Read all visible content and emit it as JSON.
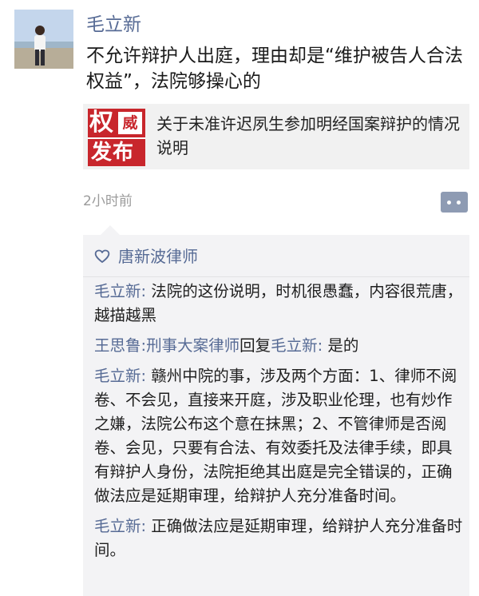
{
  "post": {
    "author": "毛立新",
    "text": "不允许辩护人出庭，理由却是“维护被告人合法权益”，法院够操心的",
    "time": "2小时前"
  },
  "shared": {
    "thumb_char_1": "权",
    "thumb_char_2": "威",
    "thumb_bottom": "发布",
    "title": "关于未准许迟夙生参加明经国案辩护的情况说明"
  },
  "likes": {
    "names": "唐新波律师"
  },
  "comments": [
    {
      "author": "毛立新",
      "sep": ": ",
      "text": "法院的这份说明，时机很愚蠢，内容很荒唐，越描越黑"
    },
    {
      "author": "王思鲁:刑事大案律师",
      "reply_word": "回复",
      "reply_to": "毛立新",
      "sep": ": ",
      "text": "是的"
    },
    {
      "author": "毛立新",
      "sep": ": ",
      "text": "赣州中院的事，涉及两个方面：1、律师不阅卷、不会见，直接来开庭，涉及职业伦理，也有炒作之嫌，法院公布这个意在抹黑；2、不管律师是否阅卷、会见，只要有合法、有效委托及法律手续，即具有辩护人身份，法院拒绝其出庭是完全错误的，正确做法应是延期审理，给辩护人充分准备时间。"
    },
    {
      "author": "毛立新",
      "sep": ": ",
      "text": "正确做法应是延期审理，给辩护人充分准备时间。"
    }
  ],
  "colors": {
    "link_blue": "#576b95",
    "thumb_red": "#c8262c",
    "comment_bg": "#f3f3f5",
    "card_bg": "#f1f1f1"
  },
  "icons": {
    "avatar": "person-photo",
    "comment_action": "comment-dots-icon",
    "likes": "heart-icon"
  }
}
